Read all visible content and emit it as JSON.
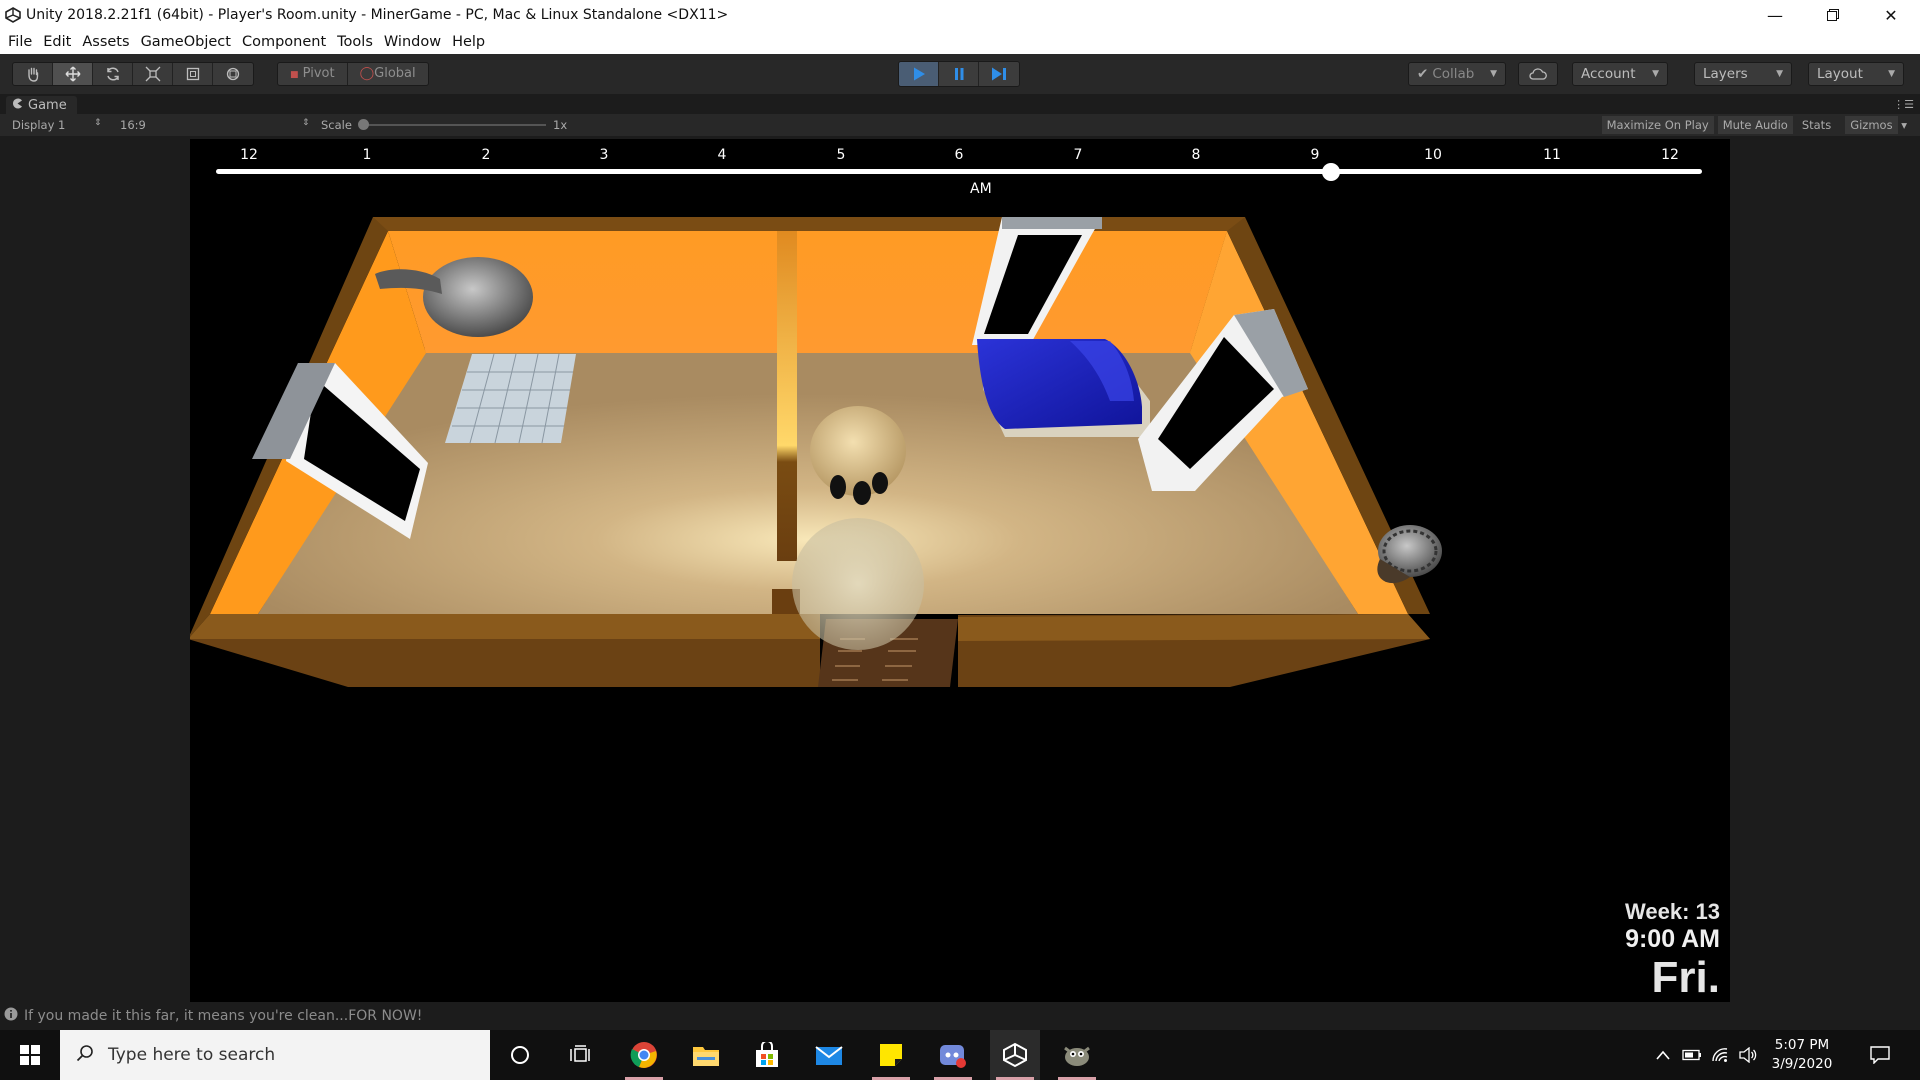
{
  "window": {
    "title": "Unity 2018.2.21f1 (64bit) - Player's Room.unity - MinerGame - PC, Mac & Linux Standalone <DX11>",
    "controls": [
      "minimize-icon",
      "restore-icon",
      "close-icon"
    ]
  },
  "menu": [
    "File",
    "Edit",
    "Assets",
    "GameObject",
    "Component",
    "Tools",
    "Window",
    "Help"
  ],
  "toolbar": {
    "tools": [
      "hand-icon",
      "move-icon",
      "rotate-icon",
      "scale-icon",
      "rect-icon",
      "transform-icon"
    ],
    "pivot_label": "Pivot",
    "global_label": "Global",
    "playback": [
      "play-icon",
      "pause-icon",
      "step-icon"
    ],
    "collab_label": "Collab",
    "account_label": "Account",
    "layers_label": "Layers",
    "layout_label": "Layout"
  },
  "game_tab": {
    "label": "Game",
    "display": "Display 1",
    "aspect": "16:9",
    "scale_label": "Scale",
    "scale_value": "1x",
    "maximize_label": "Maximize On Play",
    "mute_label": "Mute Audio",
    "stats_label": "Stats",
    "gizmos_label": "Gizmos"
  },
  "game": {
    "time_ticks": [
      "12",
      "1",
      "2",
      "3",
      "4",
      "5",
      "6",
      "7",
      "8",
      "9",
      "10",
      "11",
      "12"
    ],
    "ampm": "AM",
    "time_fraction": 0.75,
    "week": "Week: 13",
    "time": "9:00 AM",
    "day": "Fri."
  },
  "status_message": "If you made it this far, it means you're clean...FOR NOW!",
  "taskbar": {
    "search_placeholder": "Type here to search",
    "apps": [
      "cortana-icon",
      "task-view-icon",
      "chrome-icon",
      "file-explorer-icon",
      "store-icon",
      "mail-icon",
      "sticky-notes-icon",
      "discord-icon",
      "unity-icon",
      "gimp-icon"
    ],
    "time": "5:07 PM",
    "date": "3/9/2020"
  },
  "colors": {
    "wall_orange": "#ff9d2a",
    "floor": "#b89a6e",
    "bed_blue": "#1f24c4",
    "play_active": "#4a5d74"
  }
}
